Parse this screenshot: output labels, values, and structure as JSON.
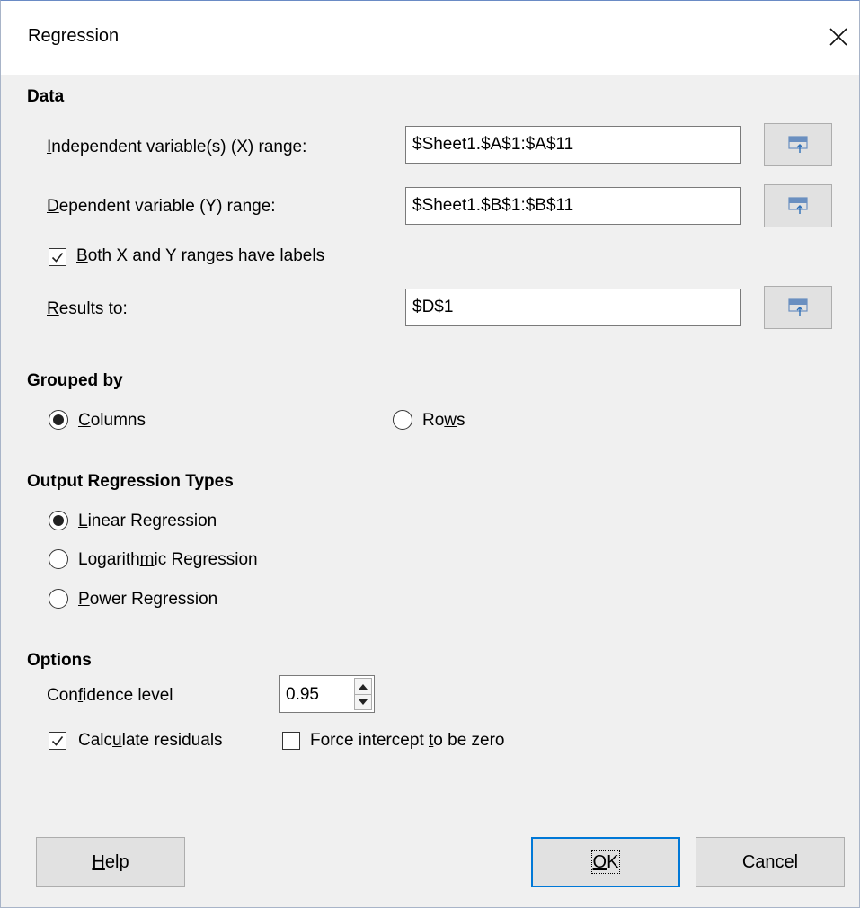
{
  "dialog": {
    "title": "Regression",
    "close_icon": "close-icon"
  },
  "data_section": {
    "title": "Data",
    "x_range": {
      "label_pre": "",
      "label_mn": "I",
      "label_post": "ndependent variable(s) (X) range:",
      "value": "$Sheet1.$A$1:$A$11"
    },
    "y_range": {
      "label_pre": "",
      "label_mn": "D",
      "label_post": "ependent variable (Y) range:",
      "value": "$Sheet1.$B$1:$B$11"
    },
    "labels_checkbox": {
      "label_pre": "",
      "label_mn": "B",
      "label_post": "oth X and Y ranges have labels",
      "checked": true
    },
    "results_to": {
      "label_pre": "",
      "label_mn": "R",
      "label_post": "esults to:",
      "value": "$D$1"
    },
    "shrink_icon": "shrink-range-icon"
  },
  "grouped_by": {
    "title": "Grouped by",
    "columns": {
      "label_pre": "",
      "label_mn": "C",
      "label_post": "olumns",
      "selected": true
    },
    "rows": {
      "label_pre": "Ro",
      "label_mn": "w",
      "label_post": "s",
      "selected": false
    }
  },
  "output_types": {
    "title": "Output Regression Types",
    "linear": {
      "label_pre": "",
      "label_mn": "L",
      "label_post": "inear Regression",
      "selected": true
    },
    "logarithmic": {
      "label_pre": "Logarith",
      "label_mn": "m",
      "label_post": "ic Regression",
      "selected": false
    },
    "power": {
      "label_pre": "",
      "label_mn": "P",
      "label_post": "ower Regression",
      "selected": false
    }
  },
  "options": {
    "title": "Options",
    "confidence": {
      "label_pre": "Con",
      "label_mn": "f",
      "label_post": "idence level",
      "value": "0.95"
    },
    "residuals": {
      "label_pre": "Calc",
      "label_mn": "u",
      "label_post": "late residuals",
      "checked": true
    },
    "force_zero": {
      "label_pre": "Force intercept ",
      "label_mn": "t",
      "label_post": "o be zero",
      "checked": false
    }
  },
  "buttons": {
    "help": {
      "label_pre": "",
      "label_mn": "H",
      "label_post": "elp"
    },
    "ok": {
      "label_pre": "",
      "label_mn": "O",
      "label_post": "K"
    },
    "cancel": {
      "label": "Cancel"
    }
  },
  "colors": {
    "accent": "#0078d7",
    "dialog_bg": "#f0f0f0",
    "titlebar_bg": "#ffffff"
  }
}
